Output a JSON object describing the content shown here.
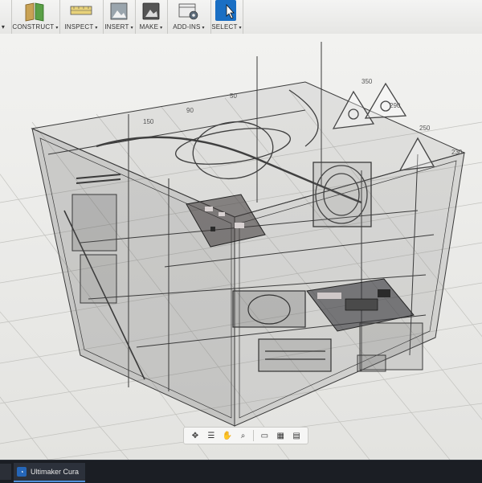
{
  "toolbar": {
    "groups": [
      {
        "label": "CONSTRUCT",
        "icon": "construct-icon"
      },
      {
        "label": "INSPECT",
        "icon": "measure-icon"
      },
      {
        "label": "INSERT",
        "icon": "insert-image-icon"
      },
      {
        "label": "MAKE",
        "icon": "make-3dprint-icon"
      },
      {
        "label": "ADD-INS",
        "icon": "addins-icon"
      },
      {
        "label": "SELECT",
        "icon": "select-cursor-icon"
      }
    ],
    "dropdown_caret": "▾"
  },
  "viewport": {
    "dimension_labels": [
      "350",
      "290",
      "250",
      "230",
      "50",
      "150",
      "90"
    ],
    "model": "transparent 3D printer enclosure assembly"
  },
  "navbar": {
    "buttons": [
      "orbit-icon",
      "pan-icon",
      "zoom-icon",
      "fit-icon",
      "display-settings-icon",
      "grid-settings-icon",
      "viewports-icon"
    ]
  },
  "taskbar": {
    "app_label": "Ultimaker Cura",
    "app_icon": "cura-icon"
  },
  "colors": {
    "select_active": "#1a6fc4",
    "taskbar": "#1b1e24",
    "grid_line": "#bcbcb8",
    "model_line": "#3a3a3a"
  }
}
